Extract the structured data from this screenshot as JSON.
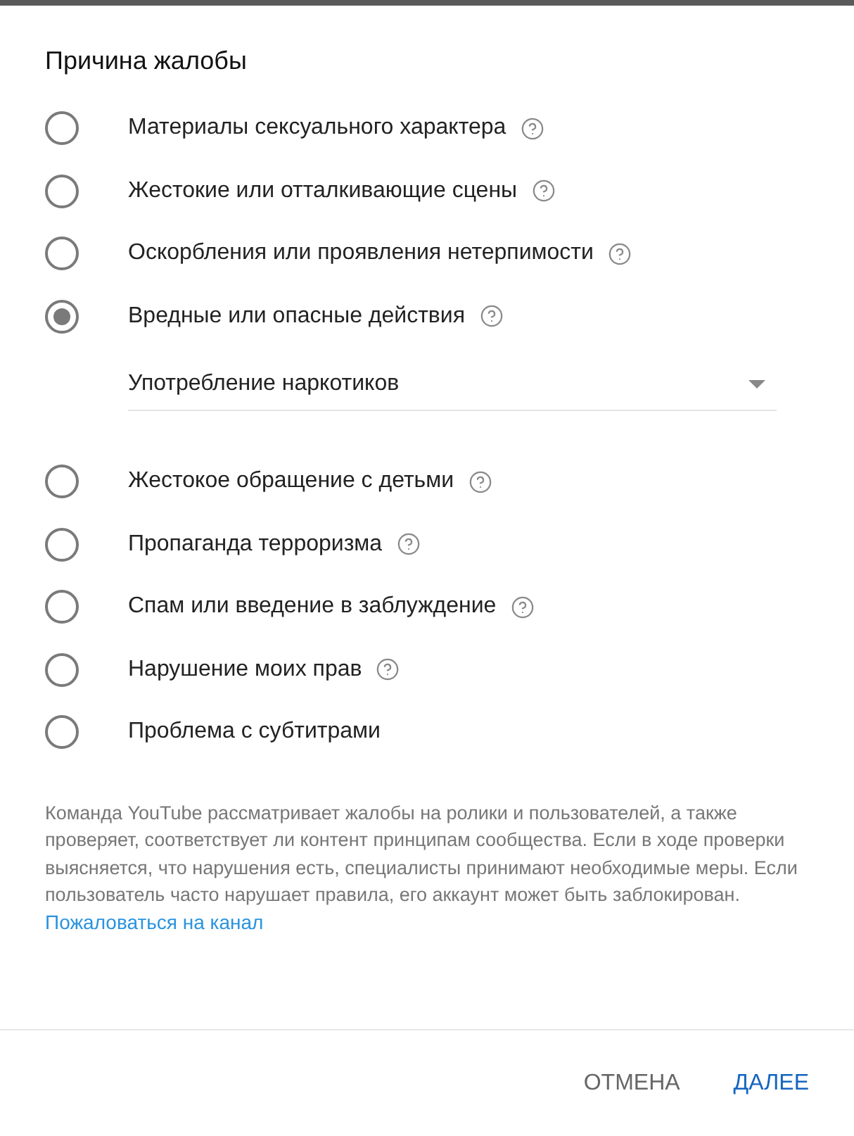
{
  "title": "Причина жалобы",
  "options": [
    {
      "label": "Материалы сексуального характера",
      "selected": false,
      "help": true
    },
    {
      "label": "Жестокие или отталкивающие сцены",
      "selected": false,
      "help": true
    },
    {
      "label": "Оскорбления или проявления нетерпимости",
      "selected": false,
      "help": true
    },
    {
      "label": "Вредные или опасные действия",
      "selected": true,
      "help": true,
      "dropdown": {
        "value": "Употребление наркотиков"
      }
    },
    {
      "label": "Жестокое обращение с детьми",
      "selected": false,
      "help": true
    },
    {
      "label": "Пропаганда терроризма",
      "selected": false,
      "help": true
    },
    {
      "label": "Спам или введение в заблуждение",
      "selected": false,
      "help": true
    },
    {
      "label": "Нарушение моих прав",
      "selected": false,
      "help": true
    },
    {
      "label": "Проблема с субтитрами",
      "selected": false,
      "help": false
    }
  ],
  "note": "Команда YouTube рассматривает жалобы на ролики и пользователей, а также проверяет, соответствует ли контент принципам сообщества. Если в ходе проверки выясняется, что нарушения есть, специалисты принимают необходимые меры. Если пользователь часто нарушает правила, его аккаунт может быть заблокирован.",
  "link": "Пожаловаться на канал",
  "buttons": [
    {
      "label": "ОТМЕНА",
      "kind": "secondary"
    },
    {
      "label": "ДАЛЕЕ",
      "kind": "primary"
    }
  ]
}
